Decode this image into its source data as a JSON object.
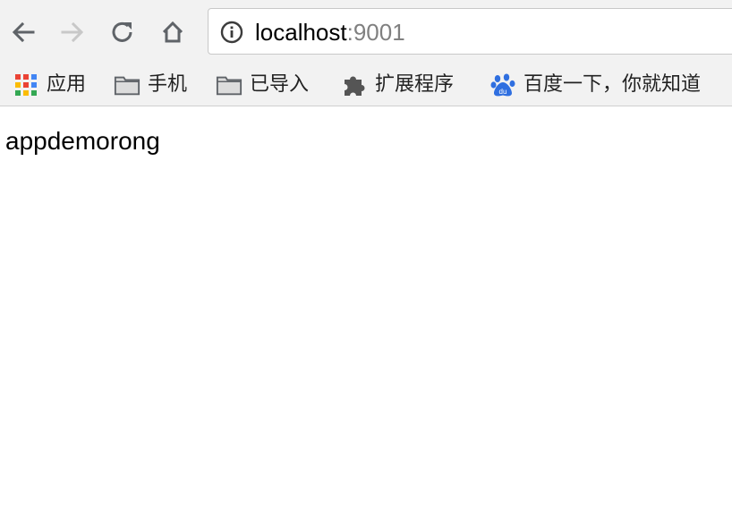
{
  "browser": {
    "address_bar": {
      "host": "localhost",
      "port": ":9001"
    },
    "bookmarks": [
      {
        "label": "应用",
        "icon": "apps-grid-icon"
      },
      {
        "label": "手机",
        "icon": "folder-icon"
      },
      {
        "label": "已导入",
        "icon": "folder-icon"
      },
      {
        "label": "扩展程序",
        "icon": "puzzle-icon"
      },
      {
        "label": "百度一下，你就知道",
        "icon": "baidu-paw-icon"
      }
    ],
    "colors": {
      "toolbar_bg": "#f2f2f2",
      "icon_gray": "#5f6368",
      "icon_disabled": "#c8c8c8",
      "port_text": "#808080"
    }
  },
  "page": {
    "text": "appdemorong"
  }
}
